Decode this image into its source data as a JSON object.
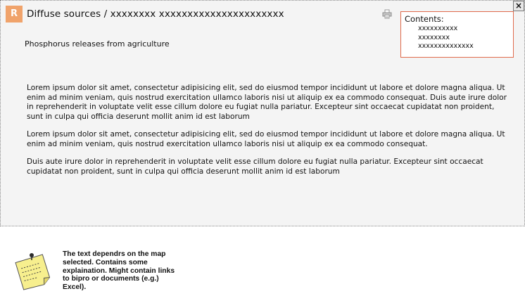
{
  "window": {
    "close_label": "×"
  },
  "header": {
    "badge_letter": "R",
    "badge_color": "#f0a36b",
    "title": "Diffuse sources / xxxxxxxx xxxxxxxxxxxxxxxxxxxxxx",
    "print_icon": "print-icon"
  },
  "contents": {
    "label": "Contents:",
    "border_color": "#e06a4c",
    "items": [
      "xxxxxxxxxx",
      "xxxxxxxx",
      "xxxxxxxxxxxxxx"
    ]
  },
  "main": {
    "subtitle": "Phosphorus releases from agriculture",
    "paragraphs": [
      "Lorem ipsum dolor sit amet, consectetur adipisicing elit, sed do eiusmod tempor incididunt ut labore et dolore magna aliqua. Ut enim ad minim veniam, quis nostrud exercitation ullamco laboris nisi ut aliquip ex ea commodo consequat. Duis aute irure dolor in reprehenderit in voluptate velit esse cillum dolore eu fugiat nulla pariatur. Excepteur sint occaecat cupidatat non proident, sunt in culpa qui officia deserunt mollit anim id est laborum",
      "Lorem ipsum dolor sit amet, consectetur adipisicing elit, sed do eiusmod tempor incididunt ut labore et dolore magna aliqua. Ut enim ad minim veniam, quis nostrud exercitation ullamco laboris nisi ut aliquip ex ea commodo consequat.",
      "Duis aute irure dolor in reprehenderit in voluptate velit esse cillum dolore eu fugiat nulla pariatur. Excepteur sint occaecat cupidatat non proident, sunt in culpa qui officia deserunt mollit anim id est laborum"
    ]
  },
  "annotation": {
    "icon": "sticky-note-icon",
    "note_color": "#f7ef8e",
    "text": "The text dependrs on the map selected. Contains some explaination. Might contain links to bipro or documents (e.g.) Excel)."
  }
}
